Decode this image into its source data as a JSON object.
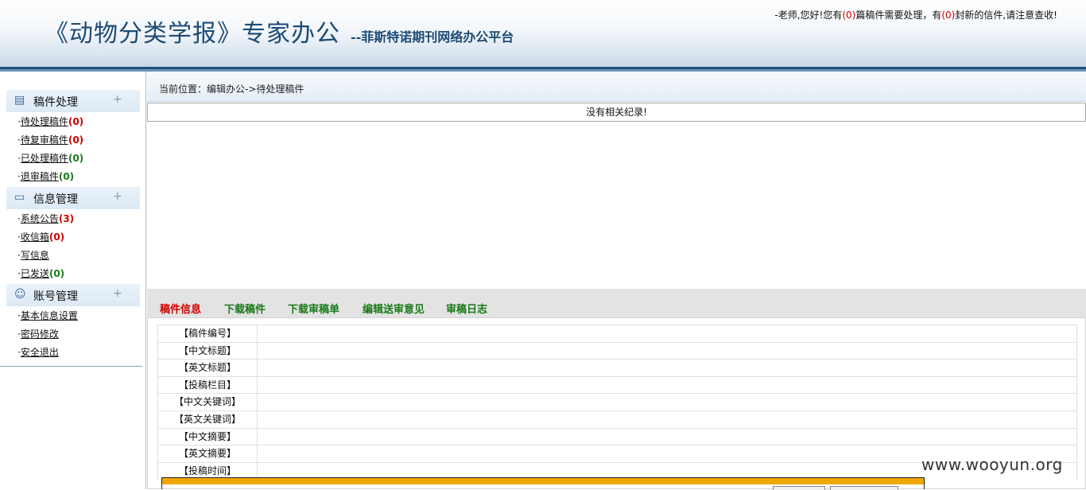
{
  "header": {
    "title": "《动物分类学报》专家办公",
    "subtitle": "--菲斯特诺期刊网络办公平台",
    "greeting_pre": "-老师,您好!您有",
    "greeting_count1": "(0)",
    "greeting_mid": "篇稿件需要处理，有",
    "greeting_count2": "(0)",
    "greeting_post": "封新的信件,请注意查收!"
  },
  "sidebar": {
    "groups": [
      {
        "label": "稿件处理",
        "icon": "document-icon",
        "plus": "+"
      },
      {
        "label": "信息管理",
        "icon": "message-icon",
        "plus": "+"
      },
      {
        "label": "账号管理",
        "icon": "user-icon",
        "plus": "+"
      }
    ],
    "items": [
      {
        "label": "待处理稿件",
        "count": "(0)"
      },
      {
        "label": "待复审稿件",
        "count": "(0)"
      },
      {
        "label": "已处理稿件",
        "count": "(0)"
      },
      {
        "label": "退审稿件",
        "count": "(0)"
      },
      {
        "label": "系统公告",
        "count": "(3)"
      },
      {
        "label": "收信箱",
        "count": "(0)"
      },
      {
        "label": "写信息",
        "count": ""
      },
      {
        "label": "已发送",
        "count": "(0)"
      },
      {
        "label": "基本信息设置",
        "count": ""
      },
      {
        "label": "密码修改",
        "count": ""
      },
      {
        "label": "安全退出",
        "count": ""
      }
    ]
  },
  "breadcrumb": "当前位置：编辑办公->待处理稿件",
  "no_record": "没有相关纪录!",
  "tabs": [
    "稿件信息",
    "下载稿件",
    "下载审稿单",
    "编辑送审意见",
    "审稿日志"
  ],
  "detail_rows": [
    "【稿件编号】",
    "【中文标题】",
    "【英文标题】",
    "【投稿栏目】",
    "【中文关键词】",
    "【英文关键词】",
    "【中文摘要】",
    "【英文摘要】",
    "【投稿时间】"
  ],
  "watermark": "www.wooyun.org",
  "colors": {
    "accent": "#1d4a74",
    "count_red": "#d00000",
    "count_green": "#1a7a1a",
    "progress": "#f0a800"
  }
}
